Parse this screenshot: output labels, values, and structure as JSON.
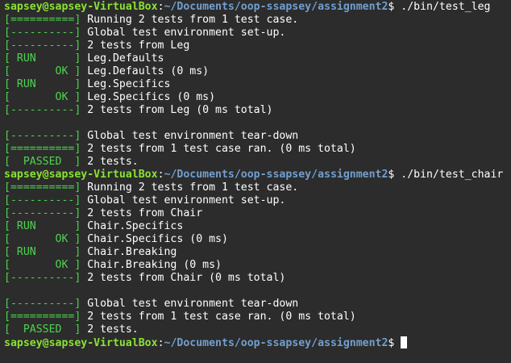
{
  "colors": {
    "background": "#2c2c2c",
    "tag": "#4ed44e",
    "user": "#8ae234",
    "path": "#729fcf",
    "text": "#ffffff"
  },
  "lines": [
    {
      "type": "prompt",
      "user": "sapsey@sapsey-VirtualBox",
      "sep": ":",
      "path": "~/Documents/oop-ssapsey/assignment2",
      "symbol": "$ ",
      "command": "./bin/test_leg"
    },
    {
      "type": "tag",
      "tag": "[==========]",
      "text": " Running 2 tests from 1 test case."
    },
    {
      "type": "tag",
      "tag": "[----------]",
      "text": " Global test environment set-up."
    },
    {
      "type": "tag",
      "tag": "[----------]",
      "text": " 2 tests from Leg"
    },
    {
      "type": "tag",
      "tag": "[ RUN      ]",
      "text": " Leg.Defaults"
    },
    {
      "type": "tag",
      "tag": "[       OK ]",
      "text": " Leg.Defaults (0 ms)"
    },
    {
      "type": "tag",
      "tag": "[ RUN      ]",
      "text": " Leg.Specifics"
    },
    {
      "type": "tag",
      "tag": "[       OK ]",
      "text": " Leg.Specifics (0 ms)"
    },
    {
      "type": "tag",
      "tag": "[----------]",
      "text": " 2 tests from Leg (0 ms total)"
    },
    {
      "type": "blank"
    },
    {
      "type": "tag",
      "tag": "[----------]",
      "text": " Global test environment tear-down"
    },
    {
      "type": "tag",
      "tag": "[==========]",
      "text": " 2 tests from 1 test case ran. (0 ms total)"
    },
    {
      "type": "tag",
      "tag": "[  PASSED  ]",
      "text": " 2 tests."
    },
    {
      "type": "prompt",
      "user": "sapsey@sapsey-VirtualBox",
      "sep": ":",
      "path": "~/Documents/oop-ssapsey/assignment2",
      "symbol": "$ ",
      "command": "./bin/test_chair"
    },
    {
      "type": "tag",
      "tag": "[==========]",
      "text": " Running 2 tests from 1 test case."
    },
    {
      "type": "tag",
      "tag": "[----------]",
      "text": " Global test environment set-up."
    },
    {
      "type": "tag",
      "tag": "[----------]",
      "text": " 2 tests from Chair"
    },
    {
      "type": "tag",
      "tag": "[ RUN      ]",
      "text": " Chair.Specifics"
    },
    {
      "type": "tag",
      "tag": "[       OK ]",
      "text": " Chair.Specifics (0 ms)"
    },
    {
      "type": "tag",
      "tag": "[ RUN      ]",
      "text": " Chair.Breaking"
    },
    {
      "type": "tag",
      "tag": "[       OK ]",
      "text": " Chair.Breaking (0 ms)"
    },
    {
      "type": "tag",
      "tag": "[----------]",
      "text": " 2 tests from Chair (0 ms total)"
    },
    {
      "type": "blank"
    },
    {
      "type": "tag",
      "tag": "[----------]",
      "text": " Global test environment tear-down"
    },
    {
      "type": "tag",
      "tag": "[==========]",
      "text": " 2 tests from 1 test case ran. (0 ms total)"
    },
    {
      "type": "tag",
      "tag": "[  PASSED  ]",
      "text": " 2 tests."
    },
    {
      "type": "prompt",
      "user": "sapsey@sapsey-VirtualBox",
      "sep": ":",
      "path": "~/Documents/oop-ssapsey/assignment2",
      "symbol": "$ ",
      "command": "",
      "cursor": true
    }
  ]
}
